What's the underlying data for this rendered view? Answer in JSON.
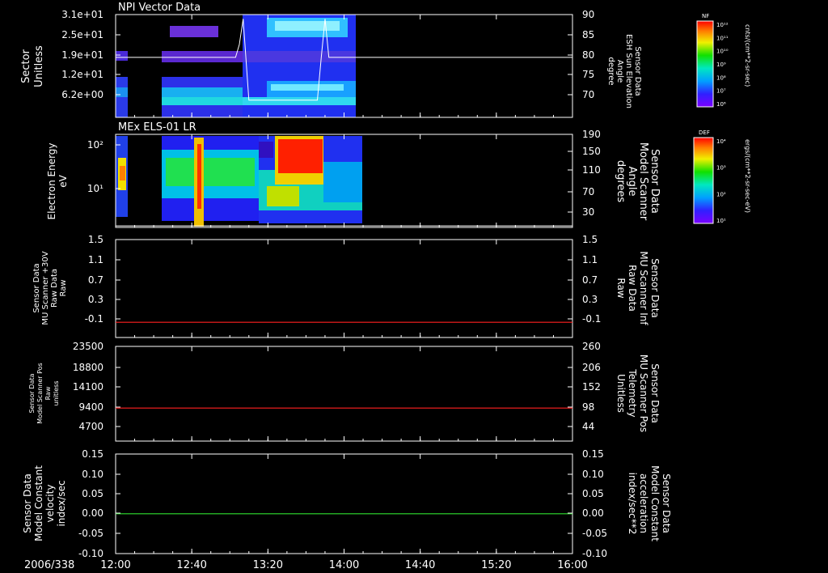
{
  "date_label": "2006/338",
  "x_ticks": [
    "12:00",
    "12:40",
    "13:20",
    "14:00",
    "14:40",
    "15:20",
    "16:00"
  ],
  "panels": [
    {
      "title": "NPI Vector Data",
      "left_label": [
        "Sector",
        "Unitless"
      ],
      "left_ticks": [
        "3.1e+01",
        "2.5e+01",
        "1.9e+01",
        "1.2e+01",
        "6.2e+00"
      ],
      "right_label": [
        "Sensor Data",
        "ESH Sun Elevation",
        "Angle",
        "degree"
      ],
      "right_ticks": [
        "90",
        "85",
        "80",
        "75",
        "70"
      ],
      "colorbar": {
        "name": "NF",
        "unit": "cnts/(cm**2-sr-sec)",
        "ticks": [
          "10¹²",
          "10¹¹",
          "10¹⁰",
          "10⁹",
          "10⁸",
          "10⁷",
          "10⁶"
        ]
      }
    },
    {
      "title": "MEx ELS-01 LR",
      "left_label": [
        "Electron Energy",
        "eV"
      ],
      "left_ticks": [
        "10²",
        "10¹"
      ],
      "right_label": [
        "Sensor Data",
        "Model Scanner",
        "Angle",
        "degrees"
      ],
      "right_ticks": [
        "190",
        "150",
        "110",
        "70",
        "30"
      ],
      "colorbar": {
        "name": "DEF",
        "unit": "ergs/(cm**2-sr-sec-eV)",
        "ticks": [
          "10⁴",
          "10³",
          "10²",
          "10¹"
        ]
      }
    },
    {
      "left_label": [
        "Sensor Data",
        "MU Scanner +30V",
        "Raw Data",
        "Raw"
      ],
      "left_ticks": [
        "1.5",
        "1.1",
        "0.7",
        "0.3",
        "-0.1"
      ],
      "right_label": [
        "Sensor Data",
        "MU Scanner Inf",
        "Raw Data",
        "Raw"
      ],
      "right_ticks": [
        "1.5",
        "1.1",
        "0.7",
        "0.3",
        "-0.1"
      ]
    },
    {
      "left_label": [
        "Sensor Data",
        "Model Scanner Pos",
        "Raw",
        "unitless"
      ],
      "left_ticks": [
        "23500",
        "18800",
        "14100",
        "9400",
        "4700"
      ],
      "right_label": [
        "Sensor Data",
        "MU Scanner Pos",
        "Telemetry",
        "Unitless"
      ],
      "right_ticks": [
        "260",
        "206",
        "152",
        "98",
        "44"
      ]
    },
    {
      "left_label": [
        "Sensor Data",
        "Model Constant",
        "velocity",
        "index/sec"
      ],
      "left_ticks": [
        "0.15",
        "0.10",
        "0.05",
        "0.00",
        "-0.05",
        "-0.10"
      ],
      "right_label": [
        "Sensor Data",
        "Model Constant",
        "acceleration",
        "index/sec**2"
      ],
      "right_ticks": [
        "0.15",
        "0.10",
        "0.05",
        "0.00",
        "-0.05",
        "-0.10"
      ]
    }
  ],
  "colors": {
    "red_trace": "#ff2020",
    "green_trace": "#30e030",
    "red_label": "#ff2020",
    "green_label": "#30e030"
  },
  "chart_data": [
    {
      "type": "heatmap",
      "title": "NPI Vector Data",
      "ylabel": "Sector Unitless",
      "xrange": [
        "12:00",
        "16:00"
      ],
      "yticks": [
        31,
        25,
        19,
        12,
        6.2
      ],
      "data_extent": [
        "12:00",
        "14:05"
      ],
      "overlay_line": {
        "name": "ESH Sun Elevation Angle",
        "ylim": [
          66,
          90
        ],
        "x": [
          "12:00",
          "12:55",
          "13:03",
          "13:05",
          "13:07",
          "13:10",
          "13:46",
          "13:48",
          "13:50",
          "13:52",
          "14:00",
          "16:00"
        ],
        "y": [
          80,
          80,
          80,
          83,
          89,
          70,
          70,
          80,
          89,
          80,
          80,
          80
        ]
      }
    },
    {
      "type": "heatmap",
      "title": "MEx ELS-01 LR",
      "ylabel": "Electron Energy eV",
      "xrange": [
        "12:00",
        "16:00"
      ],
      "log_y": true,
      "data_extent": [
        "12:00",
        "14:05"
      ],
      "overlay_line": {
        "name": "Model Scanner Angle",
        "ylim": [
          10,
          190
        ],
        "x": [
          "12:00",
          "16:00"
        ],
        "y": [
          13,
          13
        ]
      }
    },
    {
      "type": "line",
      "series": [
        {
          "name": "MU Scanner +30V Raw",
          "x": [
            "12:00",
            "16:00"
          ],
          "y": [
            -0.02,
            -0.02
          ]
        }
      ],
      "ylim": [
        -0.3,
        1.5
      ]
    },
    {
      "type": "line",
      "series": [
        {
          "name": "Model Scanner Pos Raw",
          "x": [
            "12:00",
            "16:00"
          ],
          "y": [
            8200,
            8200
          ]
        }
      ],
      "ylim": [
        0,
        23500
      ]
    },
    {
      "type": "line",
      "series": [
        {
          "name": "Model Constant velocity",
          "x": [
            "12:00",
            "16:00"
          ],
          "y": [
            0.0,
            0.0
          ]
        }
      ],
      "ylim": [
        -0.1,
        0.15
      ]
    }
  ]
}
